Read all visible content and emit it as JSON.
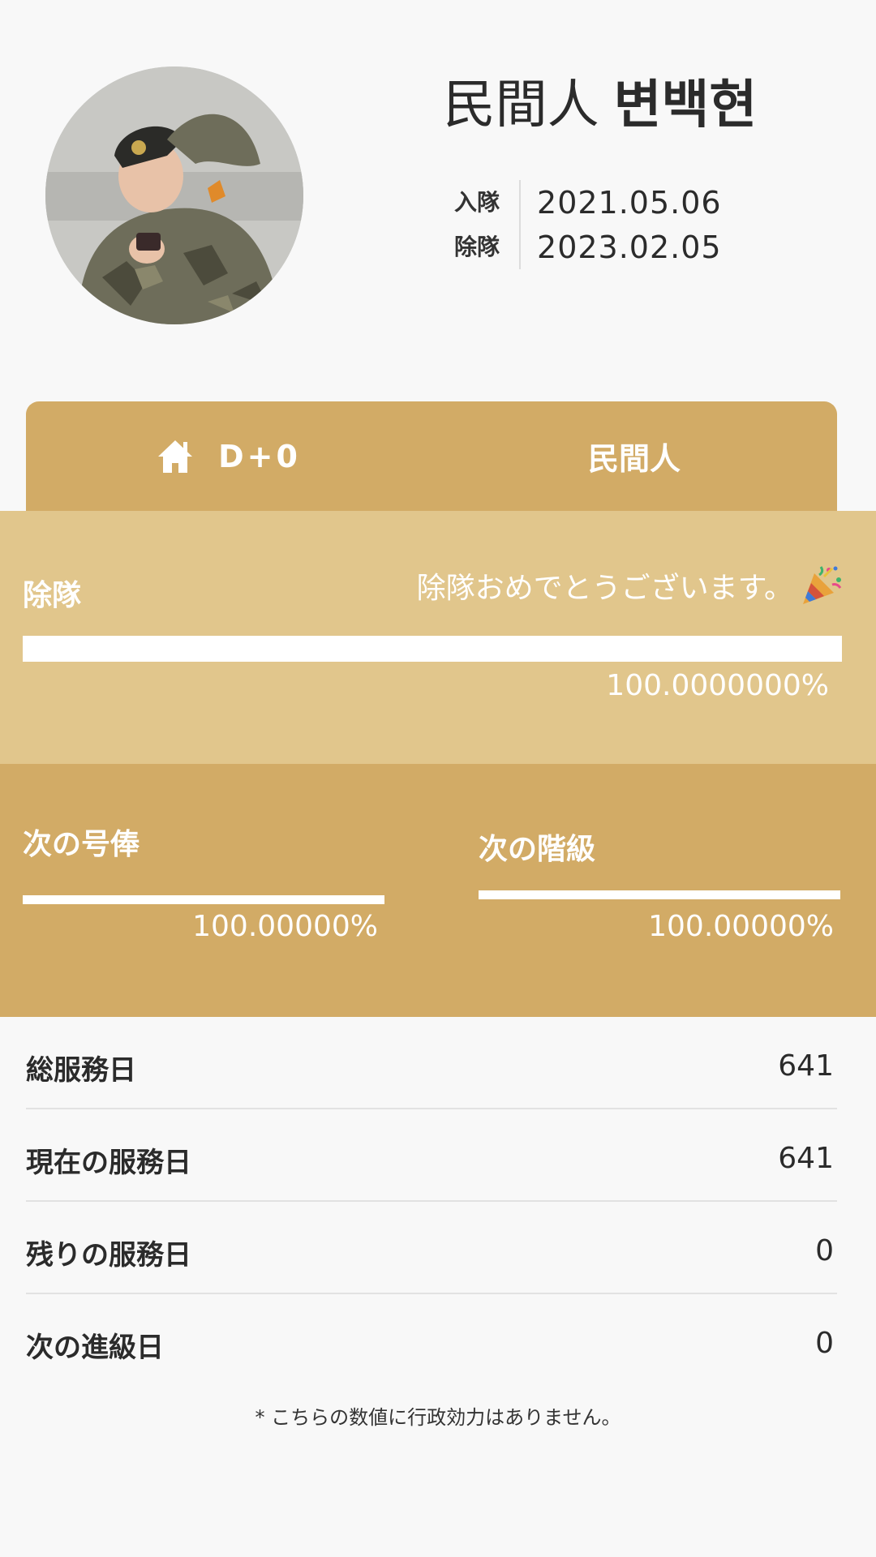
{
  "profile": {
    "rank": "民間人",
    "name": "변백현",
    "enlist_label": "入隊",
    "enlist_date": "2021.05.06",
    "discharge_label": "除隊",
    "discharge_date": "2023.02.05"
  },
  "tabs": {
    "home_icon": "home-icon",
    "dday": "D+0",
    "status": "民間人"
  },
  "discharge": {
    "title": "除隊",
    "message": "除隊おめでとうございます。",
    "message_icon": "party-popper-icon",
    "percent_text": "100.0000000%",
    "progress": 1.0
  },
  "next": {
    "salary_title": "次の号俸",
    "salary_percent_text": "100.00000%",
    "salary_progress": 1.0,
    "rank_title": "次の階級",
    "rank_percent_text": "100.00000%",
    "rank_progress": 1.0
  },
  "stats": [
    {
      "label": "総服務日",
      "value": "641"
    },
    {
      "label": "現在の服務日",
      "value": "641"
    },
    {
      "label": "残りの服務日",
      "value": "0"
    },
    {
      "label": "次の進級日",
      "value": "0"
    }
  ],
  "disclaimer": "* こちらの数値に行政効力はありません。",
  "colors": {
    "tab_gold": "#d2ab66",
    "discharge_bg": "#e1c68c",
    "page_bg": "#f8f8f8"
  }
}
